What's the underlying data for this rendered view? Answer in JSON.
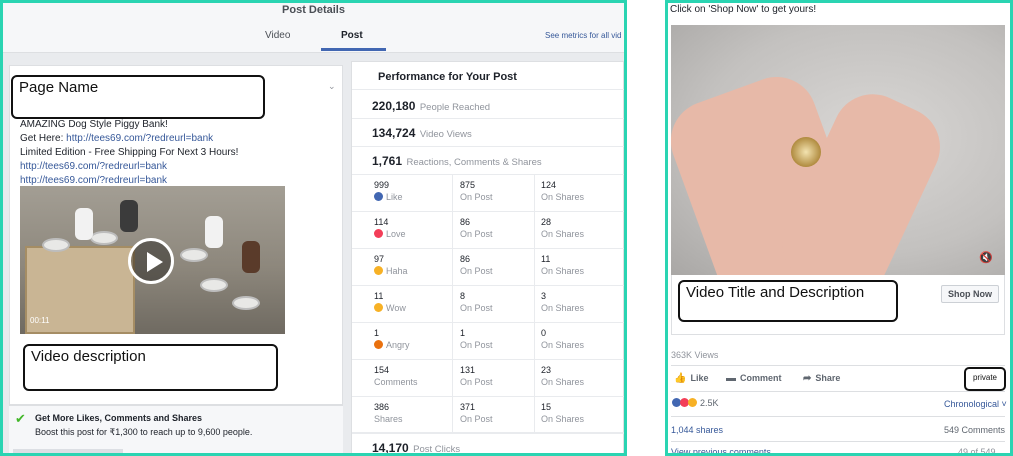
{
  "left_panel": {
    "header": {
      "title": "Post Details",
      "tabs": [
        {
          "label": "Video",
          "active": false
        },
        {
          "label": "Post",
          "active": true
        }
      ],
      "metrics_link": "See metrics for all vid"
    },
    "post": {
      "page_name_annotation": "Page Name",
      "text_lines": [
        "AMAZING Dog Style Piggy Bank!",
        "Get Here: ",
        "Limited Edition - Free Shipping For Next 3 Hours!"
      ],
      "links": [
        "http://tees69.com/?redreurl=bank",
        "http://tees69.com/?redreurl=bank",
        "http://tees69.com/?redreurl=bank"
      ],
      "video_time": "00:11",
      "video_description_annotation": "Video description"
    },
    "boost": {
      "title": "Get More Likes, Comments and Shares",
      "subtitle": "Boost this post for ₹1,300 to reach up to 9,600 people."
    },
    "performance": {
      "title": "Performance for Your Post",
      "summary": [
        {
          "value": "220,180",
          "label": "People Reached"
        },
        {
          "value": "134,724",
          "label": "Video Views"
        },
        {
          "value": "1,761",
          "label": "Reactions, Comments & Shares"
        }
      ],
      "grid": [
        {
          "total": "999",
          "label": "Like",
          "emoji": "like",
          "on_post": "875",
          "on_shares": "124"
        },
        {
          "total": "114",
          "label": "Love",
          "emoji": "love",
          "on_post": "86",
          "on_shares": "28"
        },
        {
          "total": "97",
          "label": "Haha",
          "emoji": "haha",
          "on_post": "86",
          "on_shares": "11"
        },
        {
          "total": "11",
          "label": "Wow",
          "emoji": "wow",
          "on_post": "8",
          "on_shares": "3"
        },
        {
          "total": "1",
          "label": "Angry",
          "emoji": "angry",
          "on_post": "1",
          "on_shares": "0"
        },
        {
          "total": "154",
          "label": "Comments",
          "emoji": "",
          "on_post": "131",
          "on_shares": "23"
        },
        {
          "total": "386",
          "label": "Shares",
          "emoji": "",
          "on_post": "371",
          "on_shares": "15"
        }
      ],
      "on_post_label": "On Post",
      "on_shares_label": "On Shares",
      "post_clicks": {
        "value": "14,170",
        "label": "Post Clicks"
      }
    },
    "colors": {
      "accent": "#4267b2",
      "link": "#365899",
      "frame": "#2ad4b2",
      "check": "#42b72a"
    }
  },
  "right_panel": {
    "ad_text": "Click on 'Shop Now' to get yours!",
    "video_title_annotation": "Video Title and Description",
    "shop_now": "Shop Now",
    "views": "363K Views",
    "actions": [
      {
        "label": "Like",
        "icon": "thumbs-up-icon",
        "glyph": "👍"
      },
      {
        "label": "Comment",
        "icon": "comment-icon",
        "glyph": "▬"
      },
      {
        "label": "Share",
        "icon": "share-icon",
        "glyph": "➦"
      }
    ],
    "private_label": "private",
    "reaction_count": "2.5K",
    "sort": "Chronological",
    "shares": "1,044 shares",
    "comments": "549 Comments",
    "view_previous": "View previous comments",
    "comment_count": "49 of 549"
  }
}
